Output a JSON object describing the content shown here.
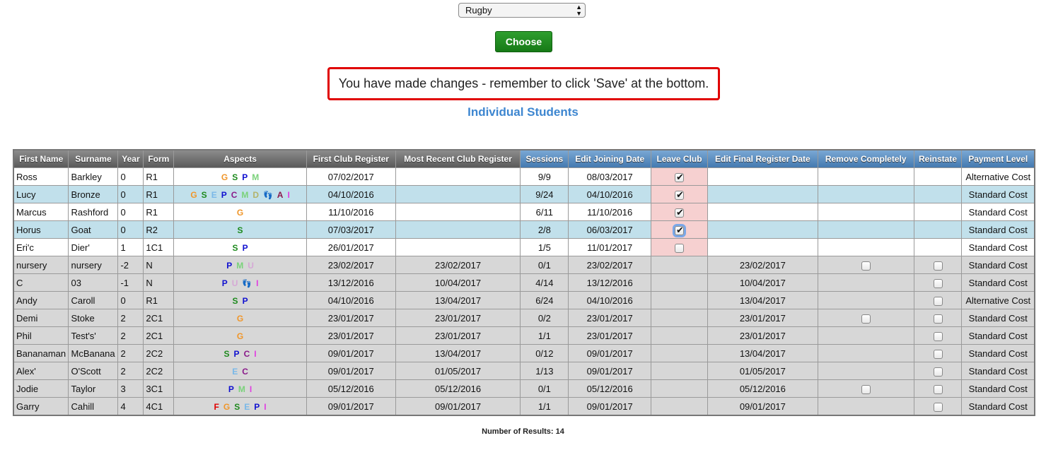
{
  "sport_select": {
    "value": "Rugby",
    "arrows": "▲▼"
  },
  "choose_button": "Choose",
  "warning": "You have made changes - remember to click 'Save' at the bottom.",
  "section_title": "Individual Students",
  "columns": [
    "First Name",
    "Surname",
    "Year",
    "Form",
    "Aspects",
    "First Club Register",
    "Most Recent Club Register",
    "Sessions",
    "Edit Joining Date",
    "Leave Club",
    "Edit Final Register Date",
    "Remove Completely",
    "Reinstate",
    "Payment Level"
  ],
  "aspect_colors": {
    "F": "#e00000",
    "G": "#f0962a",
    "S": "#1d8a1d",
    "E": "#7ab8e8",
    "P": "#1010d0",
    "C": "#8a1a8a",
    "M": "#7ad27a",
    "D": "#b3b36a",
    "U": "#d6a8d6",
    "A": "#8a1a4a",
    "I": "#e040e0"
  },
  "rows": [
    {
      "style": "white",
      "first": "Ross",
      "surname": "Barkley",
      "year": "0",
      "form": "R1",
      "aspects": [
        "G",
        "S",
        "P",
        "M"
      ],
      "first_reg": "07/02/2017",
      "recent_reg": "",
      "sessions": "9/9",
      "join": "08/03/2017",
      "leave": "checked",
      "final": "",
      "remove": "",
      "reinstate": "",
      "payment": "Alternative Cost"
    },
    {
      "style": "blue",
      "first": "Lucy",
      "surname": "Bronze",
      "year": "0",
      "form": "R1",
      "aspects": [
        "G",
        "S",
        "E",
        "P",
        "C",
        "M",
        "D",
        "foot",
        "A",
        "I"
      ],
      "first_reg": "04/10/2016",
      "recent_reg": "",
      "sessions": "9/24",
      "join": "04/10/2016",
      "leave": "checked",
      "final": "",
      "remove": "",
      "reinstate": "",
      "payment": "Standard Cost"
    },
    {
      "style": "white",
      "first": "Marcus",
      "surname": "Rashford",
      "year": "0",
      "form": "R1",
      "aspects": [
        "G"
      ],
      "first_reg": "11/10/2016",
      "recent_reg": "",
      "sessions": "6/11",
      "join": "11/10/2016",
      "leave": "checked",
      "final": "",
      "remove": "",
      "reinstate": "",
      "payment": "Standard Cost"
    },
    {
      "style": "blue",
      "first": "Horus",
      "surname": "Goat",
      "year": "0",
      "form": "R2",
      "aspects": [
        "S"
      ],
      "first_reg": "07/03/2017",
      "recent_reg": "",
      "sessions": "2/8",
      "join": "06/03/2017",
      "leave": "checked-focus",
      "final": "",
      "remove": "",
      "reinstate": "",
      "payment": "Standard Cost"
    },
    {
      "style": "white",
      "first": "Eri'c",
      "surname": "Dier'",
      "year": "1",
      "form": "1C1",
      "aspects": [
        "S",
        "P"
      ],
      "first_reg": "26/01/2017",
      "recent_reg": "",
      "sessions": "1/5",
      "join": "11/01/2017",
      "leave": "unchecked",
      "final": "",
      "remove": "",
      "reinstate": "",
      "payment": "Standard Cost"
    },
    {
      "style": "grey",
      "first": "nursery",
      "surname": "nursery",
      "year": "-2",
      "form": "N",
      "aspects": [
        "P",
        "M",
        "U"
      ],
      "first_reg": "23/02/2017",
      "recent_reg": "23/02/2017",
      "sessions": "0/1",
      "join": "23/02/2017",
      "leave": "none",
      "final": "23/02/2017",
      "remove": "box",
      "reinstate": "box",
      "payment": "Standard Cost"
    },
    {
      "style": "grey",
      "first": "C",
      "surname": "03",
      "year": "-1",
      "form": "N",
      "aspects": [
        "P",
        "U",
        "foot",
        "I"
      ],
      "first_reg": "13/12/2016",
      "recent_reg": "10/04/2017",
      "sessions": "4/14",
      "join": "13/12/2016",
      "leave": "none",
      "final": "10/04/2017",
      "remove": "",
      "reinstate": "box",
      "payment": "Standard Cost"
    },
    {
      "style": "grey",
      "first": "Andy",
      "surname": "Caroll",
      "year": "0",
      "form": "R1",
      "aspects": [
        "S",
        "P"
      ],
      "first_reg": "04/10/2016",
      "recent_reg": "13/04/2017",
      "sessions": "6/24",
      "join": "04/10/2016",
      "leave": "none",
      "final": "13/04/2017",
      "remove": "",
      "reinstate": "box",
      "payment": "Alternative Cost"
    },
    {
      "style": "grey",
      "first": "Demi",
      "surname": "Stoke",
      "year": "2",
      "form": "2C1",
      "aspects": [
        "G"
      ],
      "first_reg": "23/01/2017",
      "recent_reg": "23/01/2017",
      "sessions": "0/2",
      "join": "23/01/2017",
      "leave": "none",
      "final": "23/01/2017",
      "remove": "box",
      "reinstate": "box",
      "payment": "Standard Cost"
    },
    {
      "style": "grey",
      "first": "Phil",
      "surname": "Test's'",
      "year": "2",
      "form": "2C1",
      "aspects": [
        "G"
      ],
      "first_reg": "23/01/2017",
      "recent_reg": "23/01/2017",
      "sessions": "1/1",
      "join": "23/01/2017",
      "leave": "none",
      "final": "23/01/2017",
      "remove": "",
      "reinstate": "box",
      "payment": "Standard Cost"
    },
    {
      "style": "grey",
      "first": "Bananaman",
      "surname": "McBanana",
      "year": "2",
      "form": "2C2",
      "aspects": [
        "S",
        "P",
        "C",
        "I"
      ],
      "first_reg": "09/01/2017",
      "recent_reg": "13/04/2017",
      "sessions": "0/12",
      "join": "09/01/2017",
      "leave": "none",
      "final": "13/04/2017",
      "remove": "",
      "reinstate": "box",
      "payment": "Standard Cost"
    },
    {
      "style": "grey",
      "first": "Alex'",
      "surname": "O'Scott",
      "year": "2",
      "form": "2C2",
      "aspects": [
        "E",
        "C"
      ],
      "first_reg": "09/01/2017",
      "recent_reg": "01/05/2017",
      "sessions": "1/13",
      "join": "09/01/2017",
      "leave": "none",
      "final": "01/05/2017",
      "remove": "",
      "reinstate": "box",
      "payment": "Standard Cost"
    },
    {
      "style": "grey",
      "first": "Jodie",
      "surname": "Taylor",
      "year": "3",
      "form": "3C1",
      "aspects": [
        "P",
        "M",
        "I"
      ],
      "first_reg": "05/12/2016",
      "recent_reg": "05/12/2016",
      "sessions": "0/1",
      "join": "05/12/2016",
      "leave": "none",
      "final": "05/12/2016",
      "remove": "box",
      "reinstate": "box",
      "payment": "Standard Cost"
    },
    {
      "style": "grey",
      "first": "Garry",
      "surname": "Cahill",
      "year": "4",
      "form": "4C1",
      "aspects": [
        "F",
        "G",
        "S",
        "E",
        "P",
        "I"
      ],
      "first_reg": "09/01/2017",
      "recent_reg": "09/01/2017",
      "sessions": "1/1",
      "join": "09/01/2017",
      "leave": "none",
      "final": "09/01/2017",
      "remove": "",
      "reinstate": "box",
      "payment": "Standard Cost"
    }
  ],
  "results": "Number of Results: 14"
}
